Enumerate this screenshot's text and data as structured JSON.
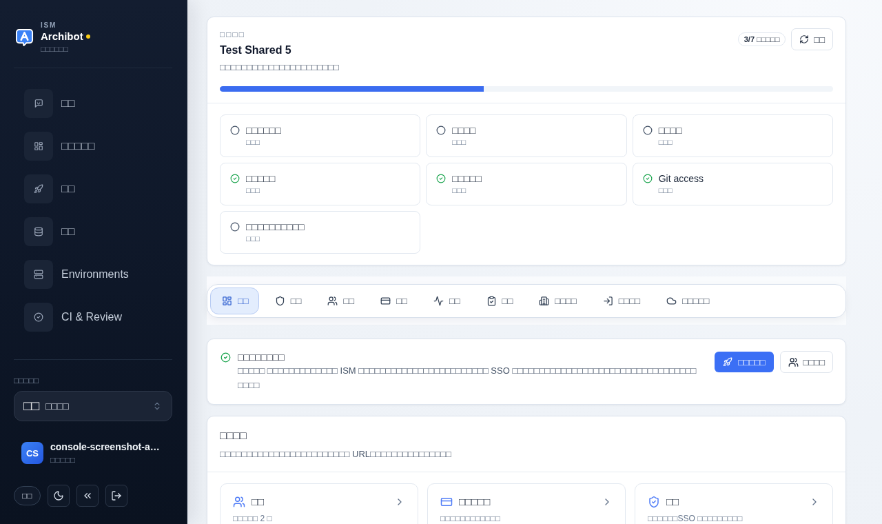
{
  "sidebar": {
    "brand": {
      "eyebrow": "ISM",
      "name": "Archibot",
      "tagline": "□□□□□□"
    },
    "nav": [
      {
        "label": "□□",
        "selected": false
      },
      {
        "label": "□□□□□",
        "selected": false
      },
      {
        "label": "□□",
        "selected": false
      },
      {
        "label": "□□",
        "selected": false
      },
      {
        "label": "Environments",
        "selected": false
      },
      {
        "label": "CI & Review",
        "selected": false
      }
    ],
    "workspace": {
      "label": "□□□□□",
      "flag": "□□",
      "value": "□□□□"
    },
    "user": {
      "initials": "CS",
      "name": "console-screenshot-a…",
      "role": "□□□□□"
    },
    "footer": {
      "language_button": "□□"
    }
  },
  "project": {
    "eyebrow": "□□□□",
    "title": "Test Shared 5",
    "description": "□□□□□□□□□□□□□□□□□□□□□□",
    "badge": "3/7 □□□□□",
    "refresh_button": "□□",
    "progress": {
      "level": 0.43
    },
    "checklist": [
      {
        "title": "□□□□□□",
        "status": "□□□",
        "done": false
      },
      {
        "title": "□□□□",
        "status": "□□□",
        "done": false
      },
      {
        "title": "□□□□",
        "status": "□□□",
        "done": false
      },
      {
        "title": "□□□□□",
        "status": "□□□",
        "done": true
      },
      {
        "title": "□□□□□",
        "status": "□□□",
        "done": true
      },
      {
        "title": "Git access",
        "status": "□□□",
        "done": true
      },
      {
        "title": "□□□□□□□□□□",
        "status": "□□□",
        "done": false
      }
    ]
  },
  "tabs": [
    {
      "label": "□□",
      "selected": true
    },
    {
      "label": "□□",
      "selected": false
    },
    {
      "label": "□□",
      "selected": false
    },
    {
      "label": "□□",
      "selected": false
    },
    {
      "label": "□□",
      "selected": false
    },
    {
      "label": "□□",
      "selected": false
    },
    {
      "label": "□□□□",
      "selected": false
    },
    {
      "label": "□□□□",
      "selected": false
    },
    {
      "label": "□□□□□",
      "selected": false
    }
  ],
  "notice": {
    "title": "□□□□□□□□",
    "body": "□□□□□ □□□□□□□□□□□□□ ISM □□□□□□□□□□□□□□□□□□□□□□□□ SSO □□□□□□□□□□□□□□□□□□□□□□□□□□□□□□□□□□□□□□",
    "primary_button": "□□□□□",
    "secondary_button": "□□□□"
  },
  "overview": {
    "title": "□□□□",
    "description": "□□□□□□□□□□□□□□□□□□□□□□□□ URL□□□□□□□□□□□□□□□",
    "cards": [
      {
        "title": "□□",
        "summary": "□□□□□ 2 □"
      },
      {
        "title": "□□□□□",
        "summary": "□□□□□□□□□□□□"
      },
      {
        "title": "□□",
        "summary": "□□□□□□SSO □□□□□□□□□"
      }
    ]
  }
}
